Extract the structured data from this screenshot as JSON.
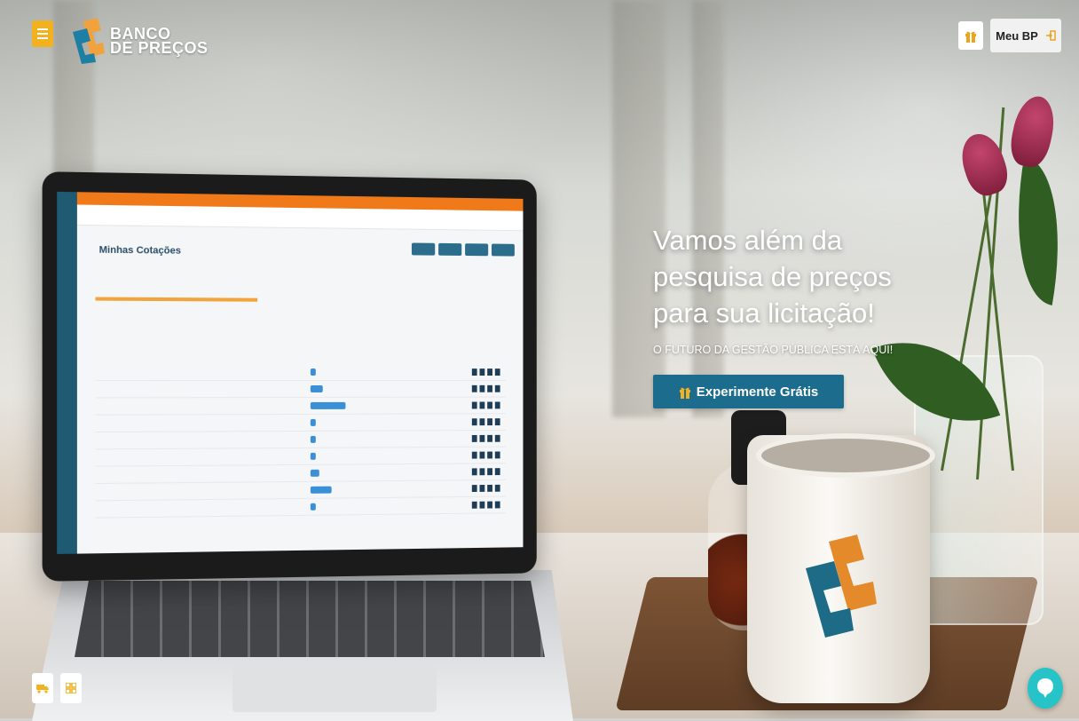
{
  "brand": {
    "line1": "BANCO",
    "line2": "DE PREÇOS"
  },
  "header": {
    "account_label": "Meu BP"
  },
  "hero": {
    "title": "Vamos além da pesquisa de preços para sua licitação!",
    "subtitle": "O FUTURO DA GESTÃO PÚBLICA ESTÁ AQUI!",
    "cta_label": "Experimente Grátis"
  },
  "laptop_screen": {
    "title": "Minhas Cotações"
  },
  "icons": {
    "menu": "hamburger-icon",
    "gift": "gift-icon",
    "login": "login-icon",
    "truck": "truck-icon",
    "grid": "grid-icon",
    "chat": "chat-bubble-icon"
  },
  "colors": {
    "accent_yellow": "#f2b220",
    "cta_blue": "#1c6d8d",
    "chat_teal": "#26c3c8",
    "brand_orange": "#f07a19"
  }
}
